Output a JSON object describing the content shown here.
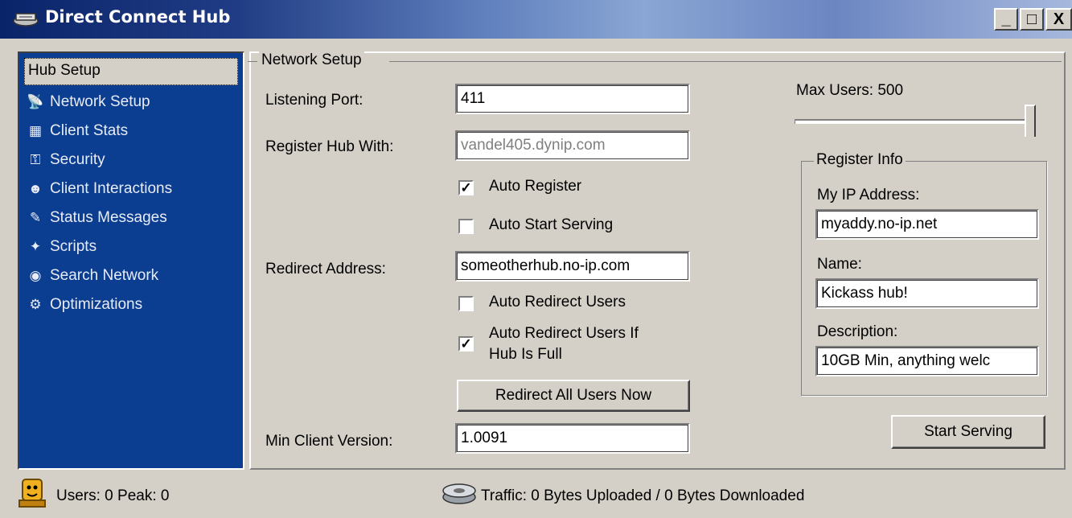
{
  "window": {
    "title": "Direct Connect Hub",
    "controls": [
      "_",
      "□",
      "X"
    ]
  },
  "sidebar": {
    "selected": "Hub Setup",
    "items": [
      {
        "label": "Network Setup",
        "icon": "satellite-dish-icon",
        "glyph": "📡"
      },
      {
        "label": "Client Stats",
        "icon": "monitor-icon",
        "glyph": "▦"
      },
      {
        "label": "Security",
        "icon": "keys-icon",
        "glyph": "⚿"
      },
      {
        "label": "Client Interactions",
        "icon": "person-icon",
        "glyph": "☻"
      },
      {
        "label": "Status Messages",
        "icon": "tools-icon",
        "glyph": "✎"
      },
      {
        "label": "Scripts",
        "icon": "script-icon",
        "glyph": "✦"
      },
      {
        "label": "Search Network",
        "icon": "magnifier-icon",
        "glyph": "◉"
      },
      {
        "label": "Optimizations",
        "icon": "gears-icon",
        "glyph": "⚙"
      }
    ]
  },
  "network": {
    "group_title": "Network Setup",
    "listening_port_label": "Listening Port:",
    "listening_port_value": "411",
    "register_hub_label": "Register Hub With:",
    "register_hub_value": "vandel405.dynip.com",
    "auto_register_label": "Auto Register",
    "auto_register_checked": true,
    "auto_start_label": "Auto Start Serving",
    "auto_start_checked": false,
    "redirect_label": "Redirect Address:",
    "redirect_value": "someotherhub.no-ip.com",
    "auto_redirect_label": "Auto Redirect Users",
    "auto_redirect_checked": false,
    "auto_redirect_full_line1": "Auto Redirect Users If",
    "auto_redirect_full_line2": "Hub Is Full",
    "auto_redirect_full_checked": true,
    "redirect_all_button": "Redirect All Users Now",
    "min_client_label": "Min Client Version:",
    "min_client_value": "1.0091"
  },
  "max_users": {
    "label": "Max Users: 500",
    "value": 500,
    "slider_fraction": 1.0
  },
  "register_info": {
    "group_title": "Register Info",
    "ip_label": "My IP Address:",
    "ip_value": "myaddy.no-ip.net",
    "name_label": "Name:",
    "name_value": "Kickass hub!",
    "description_label": "Description:",
    "description_value": "10GB Min, anything welc"
  },
  "start_button": "Start Serving",
  "statusbar": {
    "users": "Users: 0 Peak: 0",
    "traffic": "Traffic: 0 Bytes Uploaded  /  0 Bytes Downloaded"
  },
  "colors": {
    "sidebar_bg": "#0b3d91",
    "titlebar_start": "#0a246a",
    "face": "#d4d0c8"
  }
}
